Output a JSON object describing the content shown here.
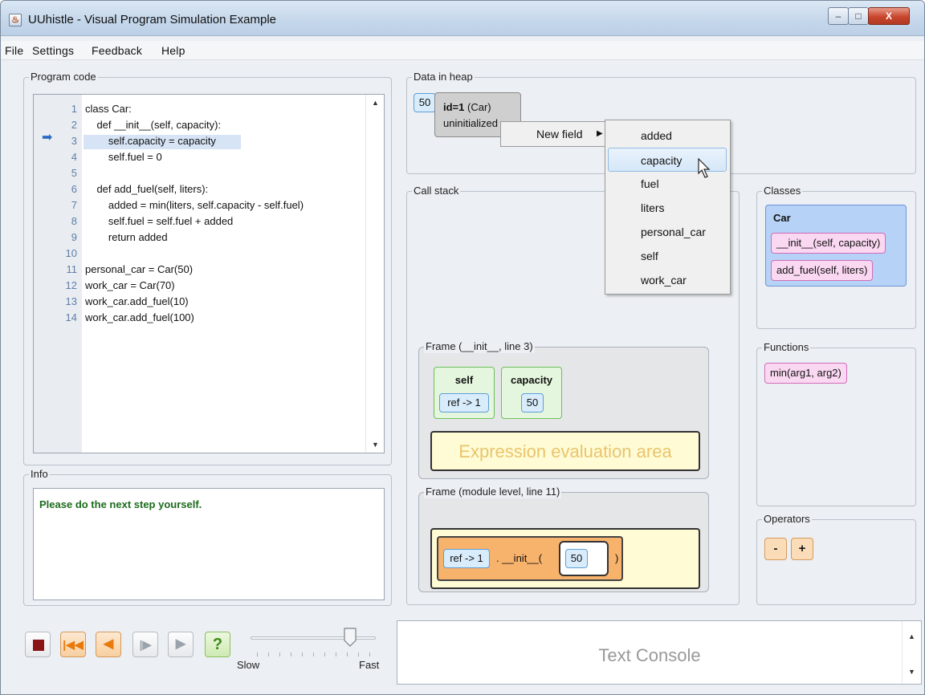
{
  "window": {
    "title": "UUhistle - Visual Program Simulation Example",
    "app_icon": "java-cup-icon",
    "controls": {
      "minimize": "–",
      "maximize": "□",
      "close": "X"
    }
  },
  "menu": [
    "File",
    "Settings",
    "Feedback",
    "Help"
  ],
  "program_code": {
    "label": "Program code",
    "current_line": 3,
    "lines": [
      {
        "n": "1",
        "text": "class Car:"
      },
      {
        "n": "2",
        "text": "    def __init__(self, capacity):"
      },
      {
        "n": "3",
        "text": "        self.capacity = capacity"
      },
      {
        "n": "4",
        "text": "        self.fuel = 0"
      },
      {
        "n": "5",
        "text": ""
      },
      {
        "n": "6",
        "text": "    def add_fuel(self, liters):"
      },
      {
        "n": "7",
        "text": "        added = min(liters, self.capacity - self.fuel)"
      },
      {
        "n": "8",
        "text": "        self.fuel = self.fuel + added"
      },
      {
        "n": "9",
        "text": "        return added"
      },
      {
        "n": "10",
        "text": ""
      },
      {
        "n": "11",
        "text": "personal_car = Car(50)"
      },
      {
        "n": "12",
        "text": "work_car = Car(70)"
      },
      {
        "n": "13",
        "text": "work_car.add_fuel(10)"
      },
      {
        "n": "14",
        "text": "work_car.add_fuel(100)"
      }
    ]
  },
  "info": {
    "label": "Info",
    "message": "Please do the next step yourself."
  },
  "heap": {
    "label": "Data in heap",
    "value": "50",
    "object": {
      "id": "id=1",
      "type": "(Car)",
      "status": "uninitialized"
    }
  },
  "context_menu": {
    "item": "New field",
    "arrow": "▶",
    "submenu": [
      "added",
      "capacity",
      "fuel",
      "liters",
      "personal_car",
      "self",
      "work_car"
    ],
    "selected": "capacity"
  },
  "call_stack": {
    "label": "Call stack",
    "frames": [
      {
        "label": "Frame (__init__, line 3)",
        "vars": [
          {
            "name": "self",
            "value": "ref -> 1"
          },
          {
            "name": "capacity",
            "value": "50"
          }
        ],
        "expression_area": "Expression evaluation area"
      },
      {
        "label": "Frame (module level, line 11)",
        "call": {
          "ref": "ref -> 1",
          "method": ". __init__(",
          "arg": "50",
          "close": ")"
        }
      }
    ]
  },
  "classes": {
    "label": "Classes",
    "items": [
      {
        "name": "Car",
        "methods": [
          "__init__(self, capacity)",
          "add_fuel(self, liters)"
        ]
      }
    ]
  },
  "functions": {
    "label": "Functions",
    "items": [
      "min(arg1, arg2)"
    ]
  },
  "operators": {
    "label": "Operators",
    "items": [
      "-",
      "+"
    ]
  },
  "controls": {
    "help": "?",
    "speed_min": "Slow",
    "speed_max": "Fast",
    "speed": 0.8
  },
  "console": {
    "placeholder": "Text Console"
  },
  "colors": {
    "code_highlight": "#d6e4f5",
    "info_message": "#1c6b1c",
    "value_box": "#d8ecfb",
    "variable_box": "#e5f6de",
    "class_card": "#b7d2f7",
    "method_box": "#fbd8f2",
    "call_box": "#f7b26b",
    "expression_area": "#fffbd4",
    "stop": "#8a1414"
  }
}
